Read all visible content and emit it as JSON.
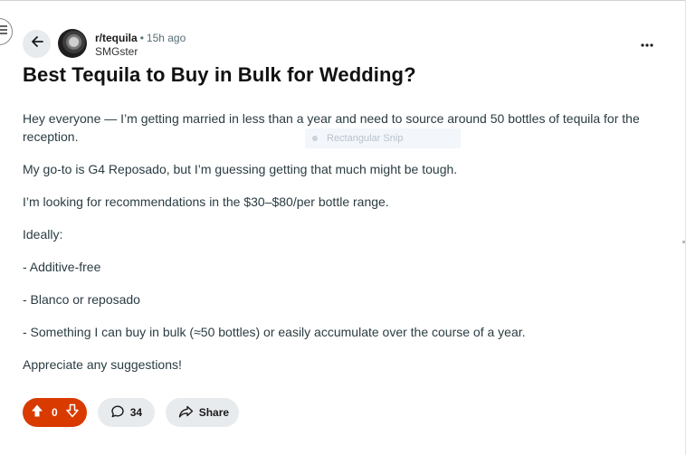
{
  "post": {
    "subreddit": "r/tequila",
    "separator": "•",
    "time_ago": "15h ago",
    "author": "SMGster",
    "title": "Best Tequila to Buy in Bulk for Wedding?",
    "paragraphs": [
      "Hey everyone — I’m getting married in less than a year and need to source around 50 bottles of tequila for the reception.",
      "My go-to is G4 Reposado, but I’m guessing getting that much might be tough.",
      "I’m looking for recommendations in the $30–$80/per bottle range.",
      "Ideally:",
      "- Additive-free",
      "- Blanco or reposado",
      "- Something I can buy in bulk (≈50 bottles) or easily accumulate over the course of a year.",
      "Appreciate any suggestions!"
    ]
  },
  "overlay": {
    "snip_label": "Rectangular Snip"
  },
  "actions": {
    "vote_count": "0",
    "comment_count": "34",
    "share_label": "Share"
  },
  "icons": {
    "menu": "hamburger-menu-icon",
    "back": "arrow-left-icon",
    "more": "more-horizontal-icon",
    "upvote": "arrow-up-icon",
    "downvote": "arrow-down-icon",
    "comment": "speech-bubble-icon",
    "share": "share-arrow-icon"
  },
  "colors": {
    "vote_active": "#d93a00",
    "pill_bg": "#e8ebed",
    "meta_text": "#576f76",
    "body_text": "#2a3c42"
  }
}
